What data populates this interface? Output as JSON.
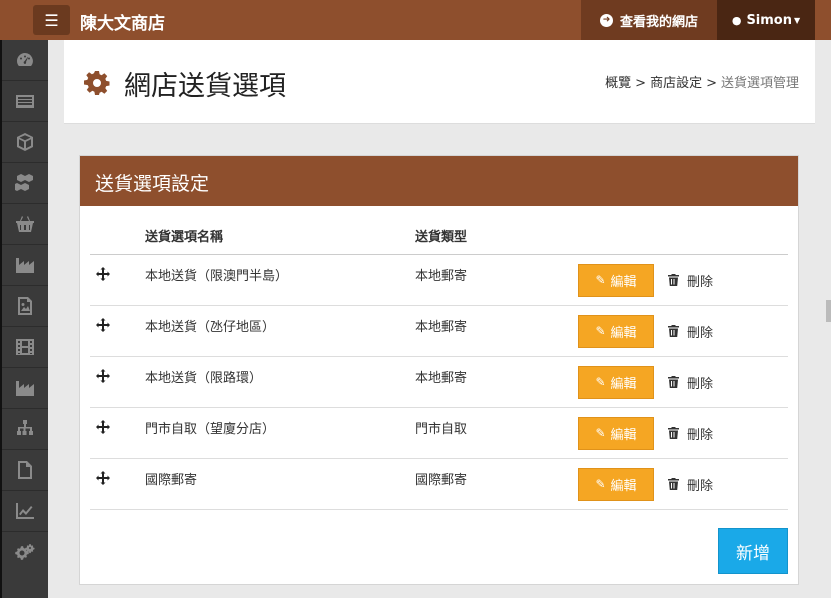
{
  "topbar": {
    "brand": "陳大文商店",
    "view_shop": "查看我的網店",
    "user": "Simon"
  },
  "sidebar": {
    "items": [
      "dashboard-icon",
      "list-icon",
      "box-icon",
      "boxes-icon",
      "basket-icon",
      "factory-icon",
      "image-icon",
      "film-icon",
      "factory-icon",
      "sitemap-icon",
      "file-icon",
      "chart-icon",
      "gears-icon"
    ]
  },
  "header": {
    "title": "網店送貨選項",
    "breadcrumb": [
      "概覽",
      "商店設定",
      "送貨選項管理"
    ]
  },
  "panel": {
    "title": "送貨選項設定",
    "columns": [
      "送貨選項名稱",
      "送貨類型"
    ],
    "edit_label": "編輯",
    "delete_label": "刪除",
    "add_label": "新增",
    "rows": [
      {
        "name": "本地送貨（限澳門半島）",
        "type": "本地郵寄"
      },
      {
        "name": "本地送貨（氹仔地區）",
        "type": "本地郵寄"
      },
      {
        "name": "本地送貨（限路環）",
        "type": "本地郵寄"
      },
      {
        "name": "門市自取（望廈分店）",
        "type": "門市自取"
      },
      {
        "name": "國際郵寄",
        "type": "國際郵寄"
      }
    ]
  },
  "colors": {
    "brand": "#8e4f2d",
    "edit": "#f5a623",
    "add": "#1aa9e8"
  }
}
